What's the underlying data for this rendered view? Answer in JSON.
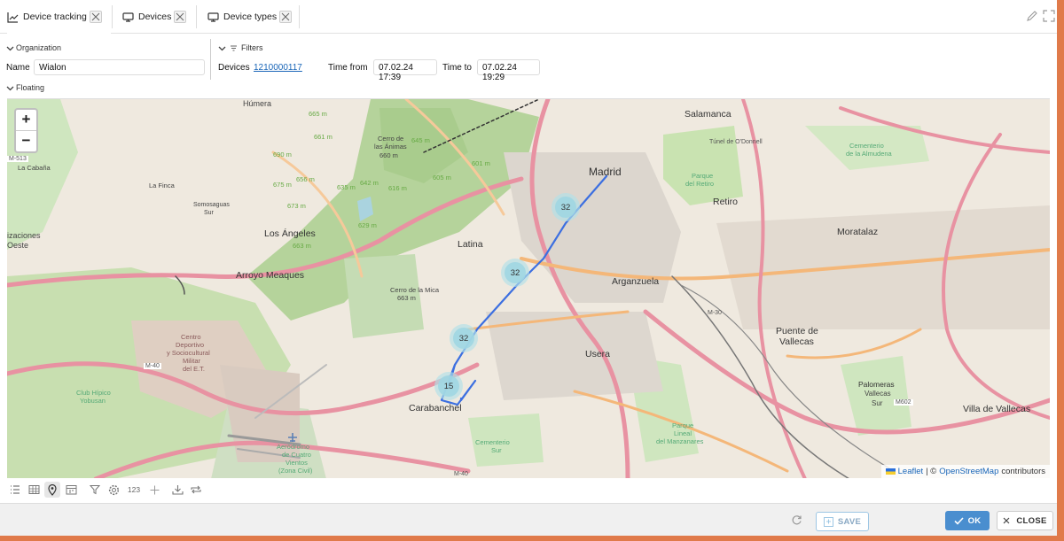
{
  "tabs": [
    {
      "label": "Device tracking",
      "icon": "chart-icon"
    },
    {
      "label": "Devices",
      "icon": "monitor-icon"
    },
    {
      "label": "Device types",
      "icon": "monitor-icon"
    }
  ],
  "filters": {
    "organization_header": "Organization",
    "filters_header": "Filters",
    "floating_header": "Floating",
    "name_label": "Name",
    "name_value": "Wialon",
    "devices_label": "Devices",
    "devices_value": "1210000117",
    "time_from_label": "Time from",
    "time_from_value": "07.02.24 17:39",
    "time_to_label": "Time to",
    "time_to_value": "07.02.24 19:29"
  },
  "map": {
    "zoom_in": "+",
    "zoom_out": "−",
    "clusters": [
      "32",
      "32",
      "32",
      "15"
    ],
    "attribution": {
      "leaflet": "Leaflet",
      "sep": "| ©",
      "osm": "OpenStreetMap",
      "rest": "contributors"
    },
    "labels": {
      "humera": "Húmera",
      "salamanca": "Salamanca",
      "madrid": "Madrid",
      "retiro": "Retiro",
      "moratalaz": "Moratalaz",
      "los_angeles": "Los Ángeles",
      "arroyo": "Arroyo Meaques",
      "latina": "Latina",
      "arganzuela": "Arganzuela",
      "usera": "Usera",
      "puente": "Puente de",
      "vallecas": "Vallecas",
      "carabanchel": "Carabanchel",
      "villa_vallecas": "Villa de Vallecas",
      "la_finca": "La Finca",
      "somosaguas": "Somosaguas",
      "sur": "Sur",
      "cabaña": "La Cabaña",
      "izaciones": "izaciones",
      "oeste": "Oeste",
      "cerro_mica": "Cerro de la Mica",
      "mica_663": "663 m",
      "cerro_animas": "Cerro de",
      "animas": "las Ánimas",
      "animas_660": "660 m",
      "centro": "Centro",
      "deportivo": "Deportivo",
      "sociocultural": "y Sociocultural",
      "militar": "Militar",
      "del_et": "del E.T.",
      "club": "Club Hípico",
      "yobusan": "Yobusan",
      "cementerio_alm": "Cementerio",
      "almudena": "de la Almudena",
      "parque": "Parque",
      "del_retiro": "del Retiro",
      "tunel": "Túnel de O'Donnell",
      "palomeras": "Palomeras",
      "vallecas_sur": "Vallecas",
      "vallecas_sur2": "Sur",
      "cementerio_sur": "Cementerio",
      "de_sur": "Sur",
      "parque_lineal": "Parque",
      "lineal": "Lineal",
      "manzanares": "del Manzanares",
      "aerodromo": "Aeródromo",
      "cuatro": "de Cuatro",
      "vientos": "Vientos",
      "zona": "(Zona Civil)",
      "m40": "M-40",
      "m40b": "M-40",
      "m513": "M-513",
      "m602": "M602",
      "m30": "M-30",
      "e_665": "665 m",
      "e_661": "661 m",
      "e_690": "690 m",
      "e_656": "656 m",
      "e_675": "675 m",
      "e_635": "635 m",
      "e_642": "642 m",
      "e_616": "616 m",
      "e_605": "605 m",
      "e_601": "601 m",
      "e_673": "673 m",
      "e_663": "663 m",
      "e_629": "629 m",
      "e_645": "645 m"
    }
  },
  "toolbar": {
    "count_label": "123"
  },
  "footer": {
    "save": "SAVE",
    "ok": "OK",
    "close": "CLOSE"
  }
}
